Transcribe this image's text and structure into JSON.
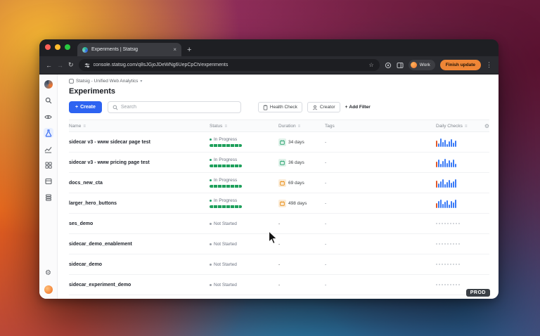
{
  "browser": {
    "tab": {
      "title": "Experiments | Statsig"
    },
    "url": "console.statsig.com/q8sJGjoJDeWNg6UepCpCh/experiments",
    "profile_label": "Work",
    "update_label": "Finish update"
  },
  "breadcrumb": {
    "label": "Statsig - Unified Web Analytics"
  },
  "page": {
    "title": "Experiments",
    "create_label": "Create",
    "search_placeholder": "Search",
    "filter_health": "Health Check",
    "filter_creator": "Creator",
    "filter_add": "Add Filter"
  },
  "table": {
    "columns": {
      "name": "Name",
      "status": "Status",
      "duration": "Duration",
      "tags": "Tags",
      "daily": "Daily Checks"
    },
    "rows": [
      {
        "name": "sidecar v3 - www sidecar page test",
        "status": "In Progress",
        "in_progress": true,
        "duration": "34 days",
        "duration_icon": "green",
        "tags": "-",
        "spark": [
          9,
          5,
          12,
          7,
          10,
          4,
          8,
          11,
          6,
          9
        ]
      },
      {
        "name": "sidecar v3 - www pricing page test",
        "status": "In Progress",
        "in_progress": true,
        "duration": "36 days",
        "duration_icon": "green",
        "tags": "-",
        "spark": [
          8,
          11,
          5,
          9,
          12,
          6,
          10,
          7,
          11,
          5
        ]
      },
      {
        "name": "docs_new_cta",
        "status": "In Progress",
        "in_progress": true,
        "duration": "69 days",
        "duration_icon": "orange",
        "tags": "-",
        "spark": [
          10,
          6,
          9,
          12,
          5,
          8,
          11,
          7,
          9,
          12
        ]
      },
      {
        "name": "larger_hero_buttons",
        "status": "In Progress",
        "in_progress": true,
        "duration": "498 days",
        "duration_icon": "orange",
        "tags": "-",
        "spark": [
          7,
          10,
          12,
          6,
          9,
          11,
          5,
          10,
          8,
          12
        ]
      },
      {
        "name": "ses_demo",
        "status": "Not Started",
        "in_progress": false,
        "duration": "-",
        "duration_icon": "none",
        "tags": "-",
        "spark": null
      },
      {
        "name": "sidecar_demo_enablement",
        "status": "Not Started",
        "in_progress": false,
        "duration": "-",
        "duration_icon": "none",
        "tags": "-",
        "spark": null
      },
      {
        "name": "sidecar_demo",
        "status": "Not Started",
        "in_progress": false,
        "duration": "-",
        "duration_icon": "none",
        "tags": "-",
        "spark": null
      },
      {
        "name": "sidecar_experiment_demo",
        "status": "Not Started",
        "in_progress": false,
        "duration": "-",
        "duration_icon": "none",
        "tags": "-",
        "spark": null
      }
    ]
  },
  "env_badge": "PROD",
  "colors": {
    "accent_blue": "#2d63f1",
    "progress_green": "#1fa05c",
    "spark_blue": "#3b7bf6",
    "spark_accent": "#e0592a",
    "duration_green": "#22a06b",
    "duration_orange": "#e8890c"
  }
}
